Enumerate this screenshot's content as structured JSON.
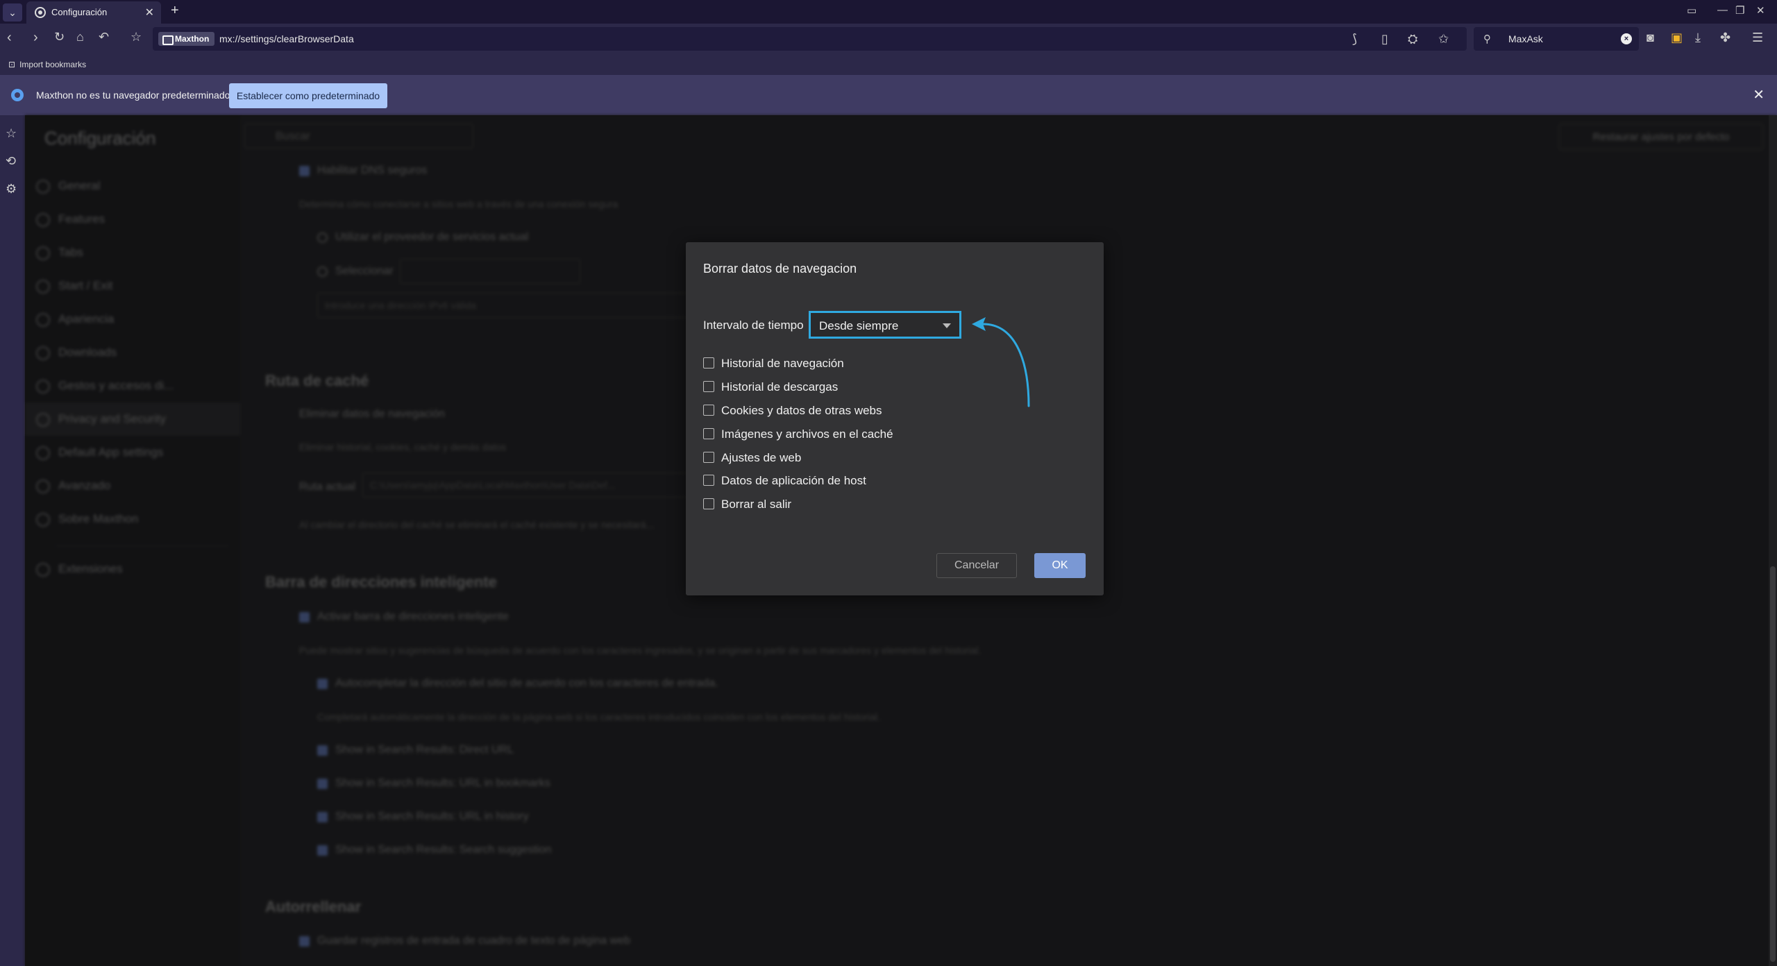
{
  "tab": {
    "title": "Configuración"
  },
  "address": {
    "brand": "Maxthon",
    "url": "mx://settings/clearBrowserData"
  },
  "search": {
    "engine": "MaxAsk"
  },
  "bookmarks": {
    "import": "Import bookmarks"
  },
  "notification": {
    "text": "Maxthon no es tu navegador predeterminado",
    "button": "Establecer como predeterminado"
  },
  "settings": {
    "title": "Configuración",
    "search_placeholder": "Buscar",
    "restore": "Restaurar ajustes por defecto",
    "nav": [
      "General",
      "Features",
      "Tabs",
      "Start / Exit",
      "Apariencia",
      "Downloads",
      "Gestos y accesos di...",
      "Privacy and Security",
      "Default App settings",
      "Avanzado",
      "Sobre Maxthon",
      "Extensiones"
    ],
    "dns": {
      "enable": "Habilitar DNS seguros",
      "desc": "Determina cómo conectarse a sitios web a través de una conexión segura",
      "current": "Utilizar el proveedor de servicios actual",
      "select": "Seleccionar",
      "custom_placeholder": "Introduce una dirección IPv6 válida"
    },
    "cache": {
      "heading": "Ruta de caché",
      "delete": "Eliminar datos de navegación",
      "delete_desc": "Eliminar historial, cookies, caché y demás datos",
      "path_label": "Ruta actual",
      "path_value": "C:\\Users\\amyjq\\AppData\\Local\\Maxthon\\User Data\\Def...",
      "note": "Al cambiar el directorio del caché se eliminará el caché existente y se necesitará..."
    },
    "smartbar": {
      "heading": "Barra de direcciones inteligente",
      "enable": "Activar barra de direcciones inteligente",
      "desc": "Puede mostrar sitios y sugerencias de búsqueda de acuerdo con los caracteres ingresados, y se originan a partir de sus marcadores y elementos del historial.",
      "autocomplete": "Autocompletar la dirección del sitio de acuerdo con los caracteres de entrada.",
      "autocomplete_desc": "Completará automáticamente la dirección de la página web si los caracteres introducidos coinciden con los elementos del historial.",
      "opts": [
        "Show in Search Results: Direct URL",
        "Show in Search Results: URL in bookmarks",
        "Show in Search Results: URL in history",
        "Show in Search Results: Search suggestion"
      ]
    },
    "autofill": {
      "heading": "Autorrellenar",
      "save": "Guardar registros de entrada de cuadro de texto de página web"
    }
  },
  "dialog": {
    "title": "Borrar datos de navegacion",
    "range_label": "Intervalo de tiempo",
    "range_value": "Desde siempre",
    "options": [
      "Historial de navegación",
      "Historial de descargas",
      "Cookies y datos de otras webs",
      "Imágenes y archivos en el caché",
      "Ajustes de web",
      "Datos de aplicación de host",
      "Borrar al salir"
    ],
    "cancel": "Cancelar",
    "ok": "OK"
  },
  "colors": {
    "accent": "#2fa9e0",
    "ok_button": "#7a98d4",
    "notif_button": "#aac6f8"
  }
}
